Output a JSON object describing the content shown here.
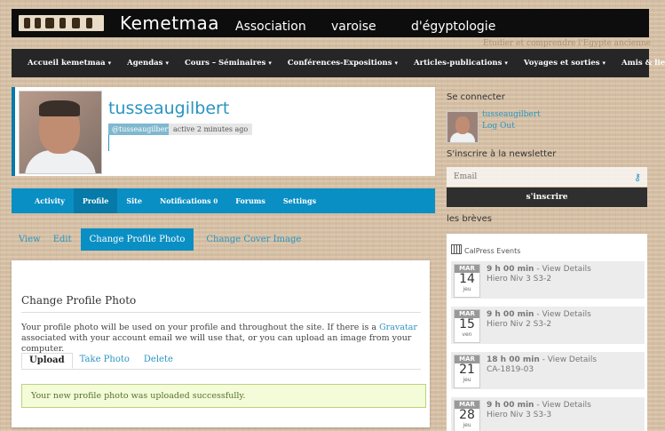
{
  "header": {
    "title": "Kemetmaa",
    "subtitle_parts": [
      "Association",
      "varoise",
      "d'égyptologie"
    ],
    "tagline": "Etudier et comprendre l'Egypte ancienne"
  },
  "nav": [
    {
      "label": "Accueil kemetmaa"
    },
    {
      "label": "Agendas"
    },
    {
      "label": "Cours – Séminaires"
    },
    {
      "label": "Conférences-Expositions"
    },
    {
      "label": "Articles-publications"
    },
    {
      "label": "Voyages et sorties"
    },
    {
      "label": "Amis & liens"
    }
  ],
  "profile": {
    "username": "tusseaugilbert",
    "mention": "@tusseaugilbert",
    "activity": "active 2 minutes ago"
  },
  "tabs": [
    {
      "label": "Activity"
    },
    {
      "label": "Profile"
    },
    {
      "label": "Site"
    },
    {
      "label": "Notifications",
      "count": "0"
    },
    {
      "label": "Forums"
    },
    {
      "label": "Settings"
    }
  ],
  "subtabs": [
    "View",
    "Edit",
    "Change Profile Photo",
    "Change Cover Image"
  ],
  "panel": {
    "title": "Change Profile Photo",
    "text_before": "Your profile photo will be used on your profile and throughout the site. If there is a ",
    "link": "Gravatar",
    "text_after": " associated with your account email we will use that, or you can upload an image from your computer.",
    "tabs": [
      "Upload",
      "Take Photo",
      "Delete"
    ],
    "success": "Your new profile photo was uploaded successfully."
  },
  "sidebar": {
    "login_title": "Se connecter",
    "user_link": "tusseaugilbert",
    "logout": "Log Out",
    "newsletter_title": "S'inscrire à la newsletter",
    "email_placeholder": "Email",
    "subscribe": "s'inscrire",
    "breves_title": "les brèves",
    "calendar_title": "CalPress Events",
    "events": [
      {
        "month": "MAR",
        "day": "14",
        "weekday": "jeu",
        "time": "9 h 00 min",
        "details": " - View Details",
        "name": "Hiero Niv 3 S3-2"
      },
      {
        "month": "MAR",
        "day": "15",
        "weekday": "ven",
        "time": "9 h 00 min",
        "details": " - View Details",
        "name": "Hiero Niv 2 S3-2"
      },
      {
        "month": "MAR",
        "day": "21",
        "weekday": "jeu",
        "time": "18 h 00 min",
        "details": " - View Details",
        "name": "CA-1819-03"
      },
      {
        "month": "MAR",
        "day": "28",
        "weekday": "jeu",
        "time": "9 h 00 min",
        "details": " - View Details",
        "name": "Hiero Niv 3 S3-3"
      }
    ]
  }
}
